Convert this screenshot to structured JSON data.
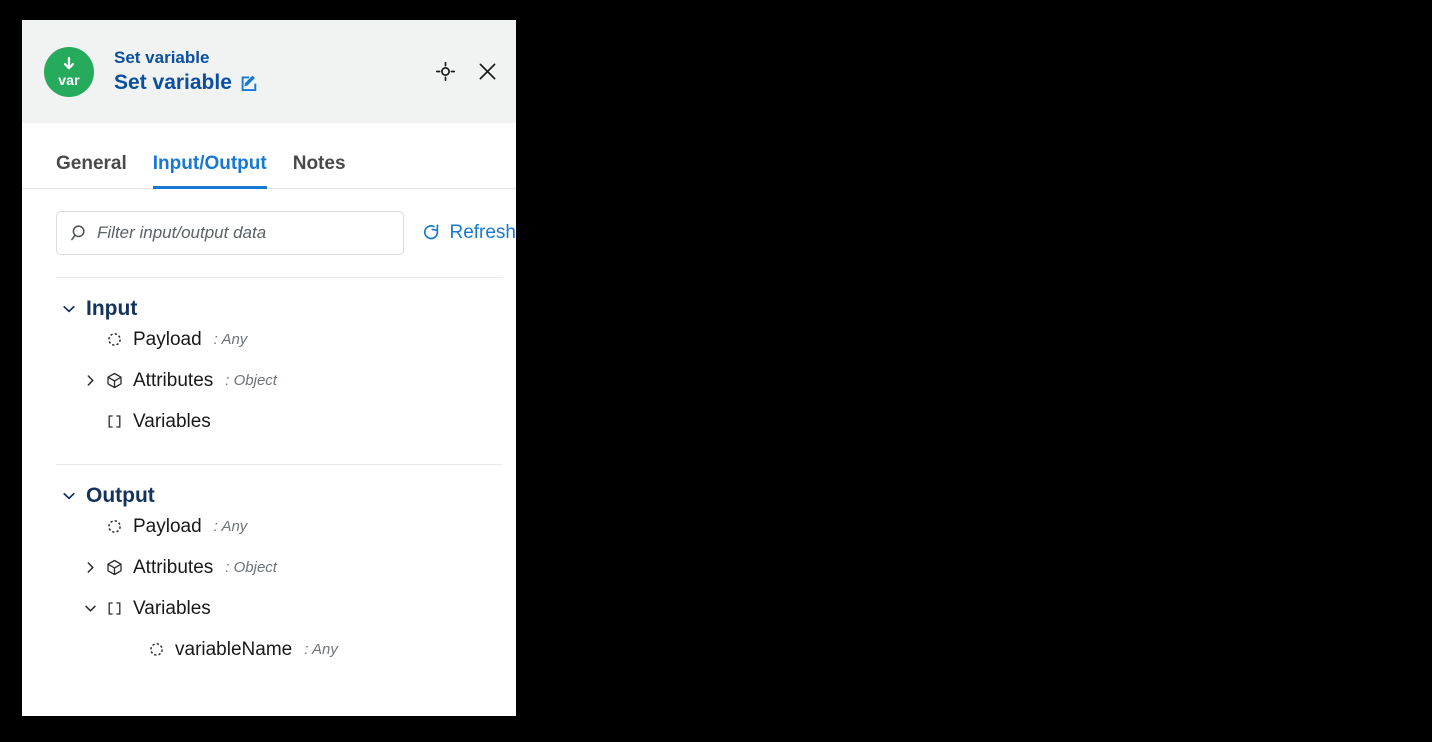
{
  "panel": {
    "header": {
      "badge_icon": "download-arrow-icon",
      "badge_text": "var",
      "node_type": "Set variable",
      "node_name": "Set variable",
      "edit_icon": "edit-pencil-icon",
      "focus_icon": "crosshair-focus-icon",
      "close_icon": "close-icon"
    },
    "tabs": [
      {
        "label": "General",
        "active": false
      },
      {
        "label": "Input/Output",
        "active": true
      },
      {
        "label": "Notes",
        "active": false
      }
    ],
    "filter": {
      "icon": "search-icon",
      "placeholder": "Filter input/output data",
      "value": "",
      "refresh_label": "Refresh",
      "refresh_icon": "refresh-icon"
    },
    "sections": [
      {
        "title": "Input",
        "expanded": true,
        "rows": [
          {
            "label": "Payload",
            "type": ": Any",
            "icon": "dotted-circle-icon",
            "twisty": "none",
            "indent": 1
          },
          {
            "label": "Attributes",
            "type": ": Object",
            "icon": "cube-icon",
            "twisty": "collapsed",
            "indent": 1
          },
          {
            "label": "Variables",
            "type": "",
            "icon": "brackets-icon",
            "twisty": "none",
            "indent": 1
          }
        ]
      },
      {
        "title": "Output",
        "expanded": true,
        "rows": [
          {
            "label": "Payload",
            "type": ": Any",
            "icon": "dotted-circle-icon",
            "twisty": "none",
            "indent": 1
          },
          {
            "label": "Attributes",
            "type": ": Object",
            "icon": "cube-icon",
            "twisty": "collapsed",
            "indent": 1
          },
          {
            "label": "Variables",
            "type": "",
            "icon": "brackets-icon",
            "twisty": "expanded",
            "indent": 1
          },
          {
            "label": "variableName",
            "type": ": Any",
            "icon": "dotted-circle-icon",
            "twisty": "none",
            "indent": 2
          }
        ]
      }
    ]
  },
  "colors": {
    "brand_blue": "#1779d3",
    "title_blue": "#0b4f9e",
    "section_navy": "#14335e",
    "badge_green": "#25ab5b",
    "header_bg": "#f1f2f2",
    "muted_text": "#6d7378",
    "canvas_bg": "#000000"
  }
}
